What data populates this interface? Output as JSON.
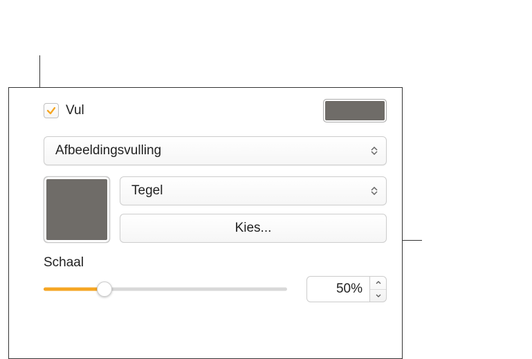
{
  "fill": {
    "checkbox_checked": true,
    "label": "Vul",
    "swatch_color": "#6f6c68",
    "type_selected": "Afbeeldingsvulling",
    "image_well_color": "#6f6c68",
    "scale_mode_selected": "Tegel",
    "choose_label": "Kies...",
    "scale_label": "Schaal",
    "scale_value": "50%",
    "slider_percent": 25,
    "accent_color": "#f5a623"
  }
}
